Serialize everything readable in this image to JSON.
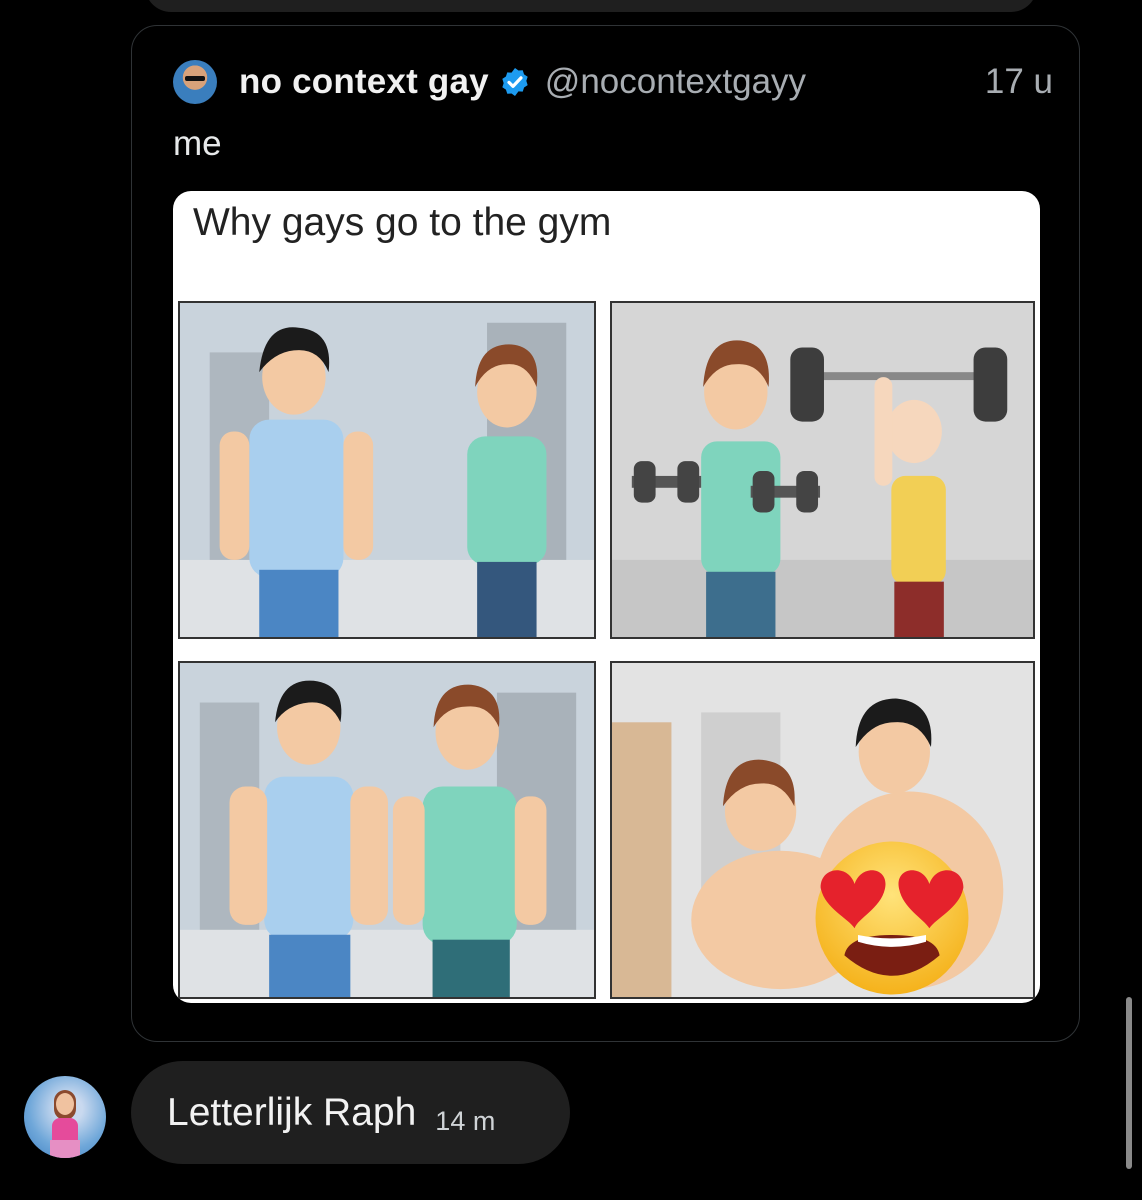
{
  "quoted_tweet": {
    "author_name": "no context gay",
    "handle": "@nocontextgayy",
    "time": "17 u",
    "text": "me",
    "verified": true,
    "avatar_icon": "profile-photo",
    "media": {
      "caption": "Why gays go to the gym",
      "panels": 4,
      "overlay_emoji": "😍"
    }
  },
  "reply": {
    "text": "Letterlijk Raph",
    "time": "14 m",
    "avatar_icon": "profile-photo"
  },
  "colors": {
    "background": "#000000",
    "bubble": "#1f1f1f",
    "verified": "#1d9bf0",
    "secondary_text": "#a8adb2"
  }
}
